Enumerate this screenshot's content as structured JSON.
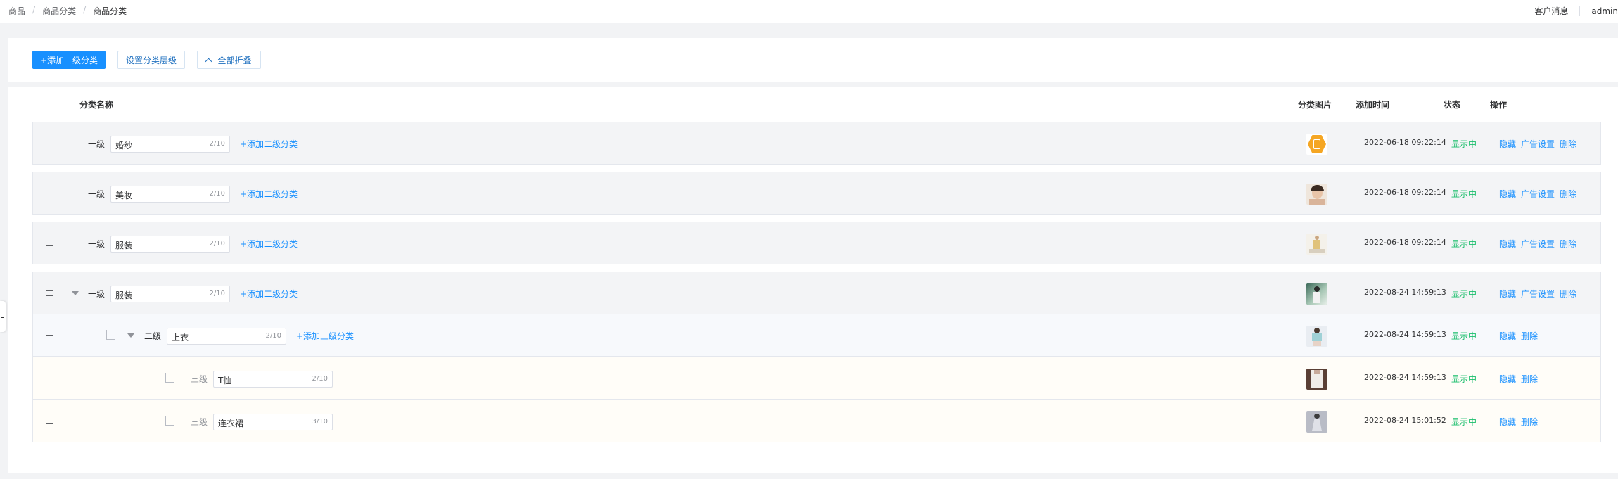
{
  "breadcrumb": [
    "商品",
    "商品分类",
    "商品分类"
  ],
  "header": {
    "customer_msg": "客户消息",
    "user": "admin"
  },
  "toolbar": {
    "add_root": "+添加一级分类",
    "set_level": "设置分类层级",
    "collapse_all": "全部折叠"
  },
  "table": {
    "headers": {
      "name": "分类名称",
      "image": "分类图片",
      "time": "添加时间",
      "status": "状态",
      "actions": "操作"
    },
    "rows": [
      {
        "level_label": "一级",
        "name": "婚纱",
        "count": "2/10",
        "add": "+添加二级分类",
        "time": "2022-06-18 09:22:14",
        "status": "显示中",
        "op_hide": "隐藏",
        "op_ad": "广告设置",
        "op_del": "删除"
      },
      {
        "level_label": "一级",
        "name": "美妆",
        "count": "2/10",
        "add": "+添加二级分类",
        "time": "2022-06-18 09:22:14",
        "status": "显示中",
        "op_hide": "隐藏",
        "op_ad": "广告设置",
        "op_del": "删除"
      },
      {
        "level_label": "一级",
        "name": "服装",
        "count": "2/10",
        "add": "+添加二级分类",
        "time": "2022-06-18 09:22:14",
        "status": "显示中",
        "op_hide": "隐藏",
        "op_ad": "广告设置",
        "op_del": "删除"
      },
      {
        "level_label": "一级",
        "name": "服装",
        "count": "2/10",
        "add": "+添加二级分类",
        "time": "2022-08-24 14:59:13",
        "status": "显示中",
        "op_hide": "隐藏",
        "op_ad": "广告设置",
        "op_del": "删除"
      },
      {
        "level_label": "二级",
        "name": "上衣",
        "count": "2/10",
        "add": "+添加三级分类",
        "time": "2022-08-24 14:59:13",
        "status": "显示中",
        "op_hide": "隐藏",
        "op_del": "删除"
      },
      {
        "level_label": "三级",
        "name": "T恤",
        "count": "2/10",
        "time": "2022-08-24 14:59:13",
        "status": "显示中",
        "op_hide": "隐藏",
        "op_del": "删除"
      },
      {
        "level_label": "三级",
        "name": "连衣裙",
        "count": "3/10",
        "time": "2022-08-24 15:01:52",
        "status": "显示中",
        "op_hide": "隐藏",
        "op_del": "删除"
      }
    ]
  },
  "colors": {
    "primary": "#1890ff",
    "status_green": "#19be6b"
  },
  "icons": [
    "drag-handle-icon",
    "caret-down-icon",
    "chevron-up-icon",
    "tree-elbow-icon"
  ]
}
